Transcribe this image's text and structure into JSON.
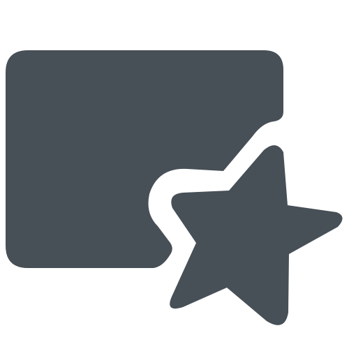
{
  "icon": {
    "semantic": "card-with-star-icon",
    "parts": [
      "rounded-rectangle-shape",
      "star-shape"
    ],
    "colors": {
      "fill": "#474f57",
      "background": "#ffffff"
    }
  }
}
